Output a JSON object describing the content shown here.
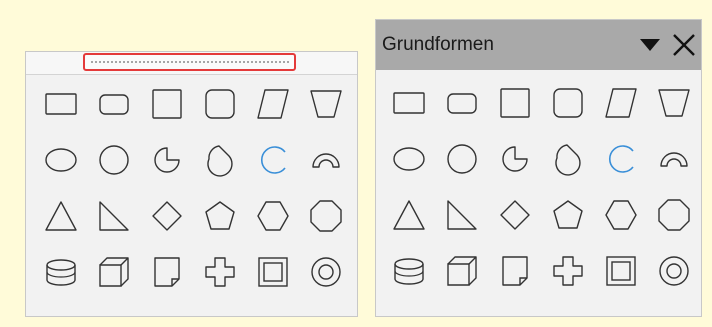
{
  "colors": {
    "background": "#fffbd9",
    "panel": "#f2f2f2",
    "titlebar": "#a9a9a9",
    "highlight_border": "#e43a3a",
    "shape_stroke": "#333333",
    "arc_stroke": "#3a8fd8"
  },
  "left_panel": {
    "grip": {
      "icon": "drag-grip-dots"
    }
  },
  "right_panel": {
    "title": "Grundformen",
    "menu_icon": "triangle-down-icon",
    "close_icon": "close-icon"
  },
  "shapes": [
    {
      "id": "rectangle",
      "icon": "rectangle-icon"
    },
    {
      "id": "rounded-rectangle",
      "icon": "rounded-rectangle-icon"
    },
    {
      "id": "square",
      "icon": "square-icon"
    },
    {
      "id": "rounded-square",
      "icon": "rounded-square-icon"
    },
    {
      "id": "parallelogram",
      "icon": "parallelogram-icon"
    },
    {
      "id": "trapezoid",
      "icon": "trapezoid-icon"
    },
    {
      "id": "ellipse",
      "icon": "ellipse-icon"
    },
    {
      "id": "circle",
      "icon": "circle-icon"
    },
    {
      "id": "circle-pie",
      "icon": "circle-pie-icon"
    },
    {
      "id": "isosceles-triangle-drop",
      "icon": "block-arc-drop-icon"
    },
    {
      "id": "arc",
      "icon": "arc-icon"
    },
    {
      "id": "block-arc",
      "icon": "block-arc-icon"
    },
    {
      "id": "isosceles-triangle",
      "icon": "isosceles-triangle-icon"
    },
    {
      "id": "right-triangle",
      "icon": "right-triangle-icon"
    },
    {
      "id": "diamond",
      "icon": "diamond-icon"
    },
    {
      "id": "pentagon",
      "icon": "pentagon-icon"
    },
    {
      "id": "hexagon",
      "icon": "hexagon-icon"
    },
    {
      "id": "octagon",
      "icon": "octagon-icon"
    },
    {
      "id": "cylinder",
      "icon": "cylinder-icon"
    },
    {
      "id": "cube",
      "icon": "cube-icon"
    },
    {
      "id": "folded-corner",
      "icon": "folded-corner-icon"
    },
    {
      "id": "cross",
      "icon": "cross-icon"
    },
    {
      "id": "frame",
      "icon": "frame-icon"
    },
    {
      "id": "ring",
      "icon": "ring-icon"
    }
  ]
}
